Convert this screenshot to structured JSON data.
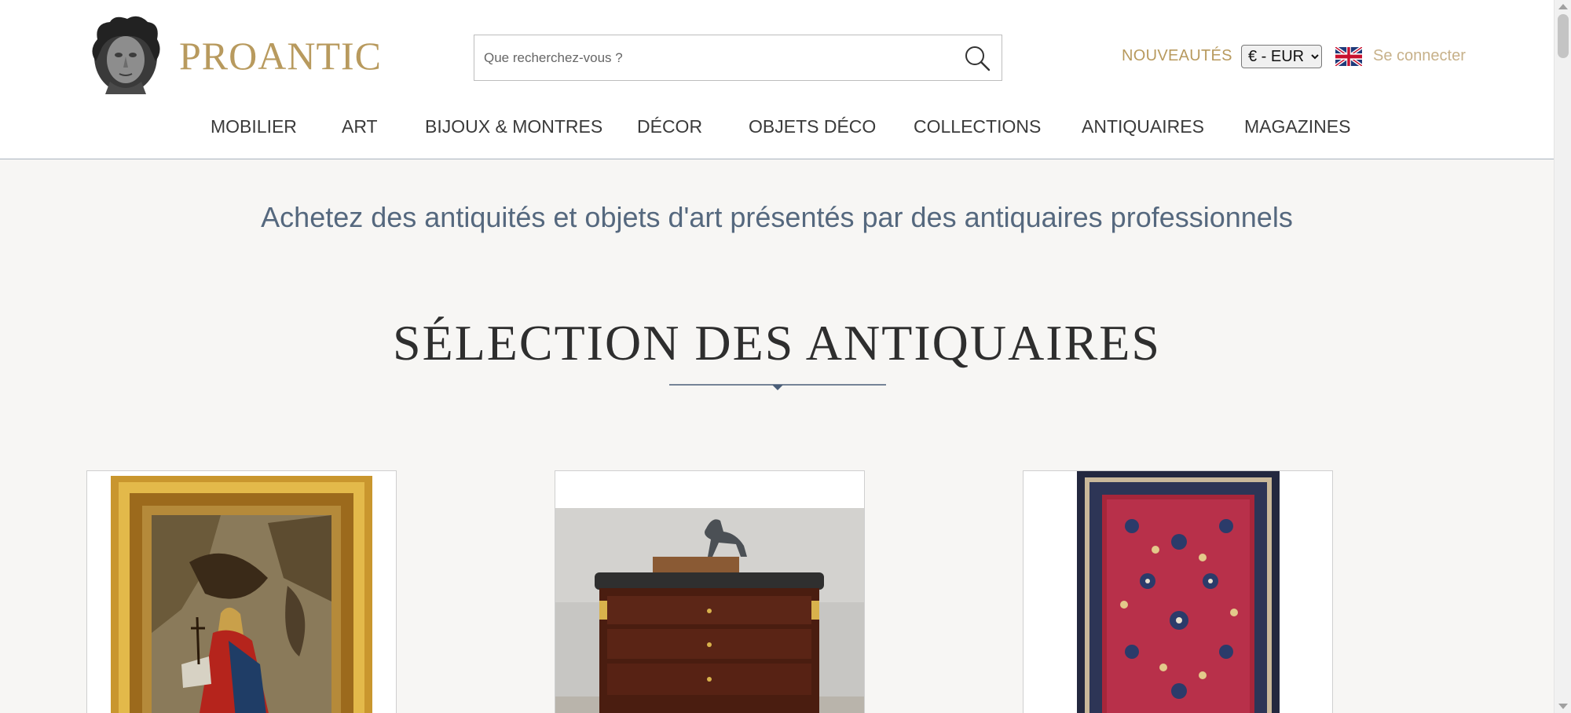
{
  "header": {
    "logo_text": "PROANTIC",
    "search_placeholder": "Que recherchez-vous ?",
    "new_label": "NOUVEAUTÉS",
    "currency_selected": "€ - EUR",
    "login_label": "Se connecter"
  },
  "nav": {
    "items": [
      "MOBILIER",
      "ART",
      "BIJOUX & MONTRES",
      "DÉCOR",
      "OBJETS DÉCO",
      "COLLECTIONS",
      "ANTIQUAIRES",
      "MAGAZINES"
    ]
  },
  "main": {
    "tagline": "Achetez des antiquités et objets d'art présentés par des antiquaires professionnels",
    "section_title": "SÉLECTION DES ANTIQUAIRES"
  },
  "cards": [
    {
      "image": "religious-painting-gilt-frame"
    },
    {
      "image": "mahogany-chest-with-deer-sculpture"
    },
    {
      "image": "red-persian-rug"
    }
  ],
  "icons": {
    "search": "search-icon",
    "flag": "uk-flag-icon",
    "logo": "bust-logo-icon"
  },
  "colors": {
    "brand_gold": "#b89a5e",
    "tagline_blue": "#55687e",
    "divider_blue": "#4a5e78"
  }
}
